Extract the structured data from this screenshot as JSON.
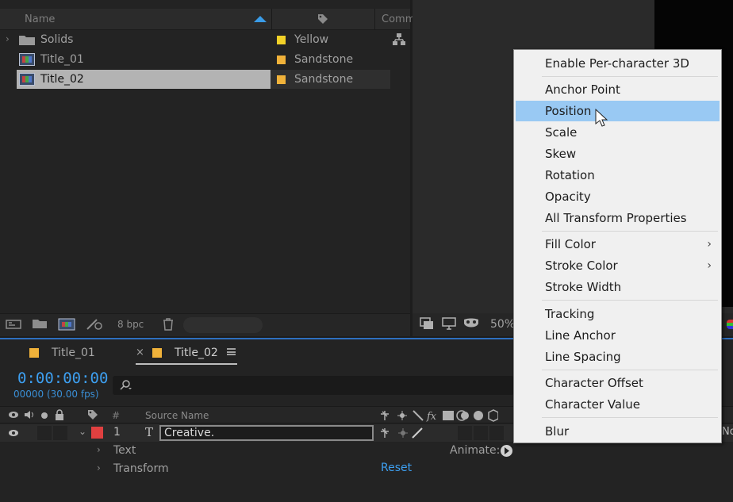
{
  "project": {
    "headers": {
      "name": "Name",
      "comment": "Comm"
    },
    "rows": [
      {
        "name": "Solids",
        "label": "Yellow",
        "color": "#f2d128"
      },
      {
        "name": "Title_01",
        "label": "Sandstone",
        "color": "#f0b23a"
      },
      {
        "name": "Title_02",
        "label": "Sandstone",
        "color": "#f0b23a"
      }
    ],
    "footer": {
      "bpc": "8 bpc"
    }
  },
  "viewer": {
    "zoom": "50%"
  },
  "timeline": {
    "tabs": [
      {
        "label": "Title_01",
        "color": "#f0b23a"
      },
      {
        "label": "Title_02",
        "color": "#f0b23a"
      }
    ],
    "timecode": "0:00:00:00",
    "frames": "00000 (30.00 fps)",
    "search_icon": "search-icon",
    "columns": {
      "number": "#",
      "source_name": "Source Name"
    },
    "layer": {
      "number": "1",
      "type_glyph": "T",
      "name": "Creative.",
      "label_color": "#e04040",
      "right_cut": "No"
    },
    "text_row": "Text",
    "animate_label": "Animate:",
    "transform_row": "Transform",
    "reset_link": "Reset"
  },
  "menu": {
    "items": [
      "Enable Per-character 3D",
      "Anchor Point",
      "Position",
      "Scale",
      "Skew",
      "Rotation",
      "Opacity",
      "All Transform Properties",
      "Fill Color",
      "Stroke Color",
      "Stroke Width",
      "Tracking",
      "Line Anchor",
      "Line Spacing",
      "Character Offset",
      "Character Value",
      "Blur"
    ],
    "selected": "Position",
    "submenu_arrow": "›"
  }
}
